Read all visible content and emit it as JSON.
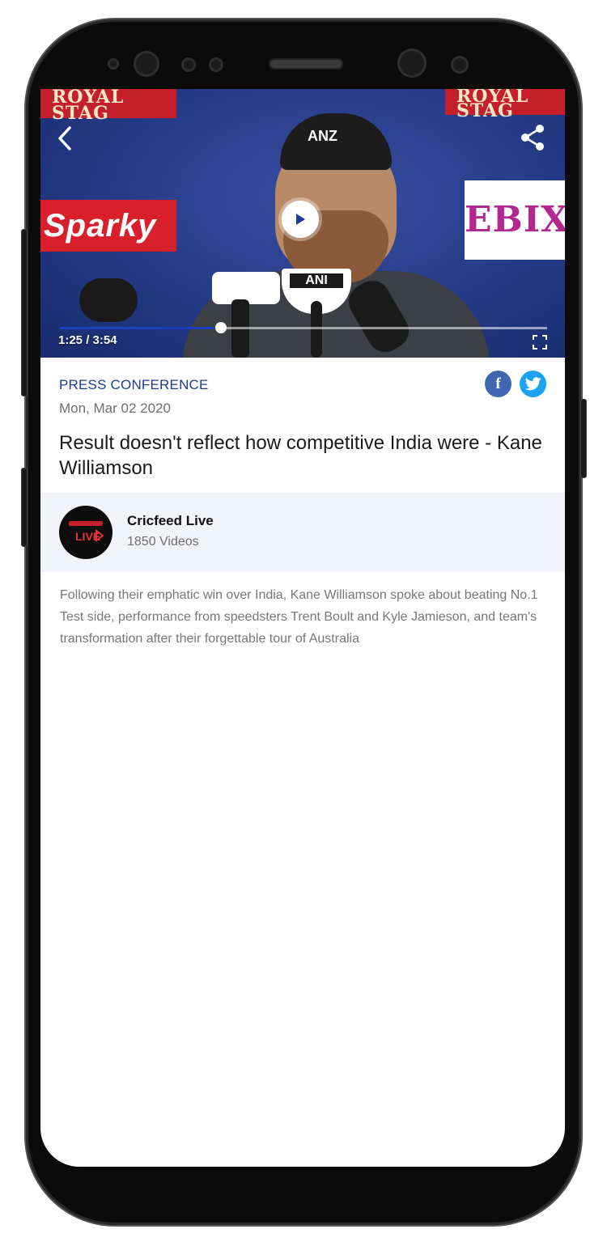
{
  "video": {
    "current_time": "1:25",
    "duration": "3:54",
    "time_label": "1:25 / 3:54",
    "progress": 0.33,
    "sponsors": [
      "ROYAL STAG",
      "Sparky",
      "EBIX",
      "ANZ",
      "ANI"
    ]
  },
  "header": {
    "back_icon": "chevron-left-icon",
    "share_icon": "share-icon"
  },
  "article": {
    "category": "PRESS CONFERENCE",
    "date": "Mon, Mar 02 2020",
    "title": "Result doesn't reflect how competitive India were - Kane Williamson",
    "description": "Following their emphatic win over India, Kane Williamson spoke about beating No.1 Test side, performance from speedsters Trent Boult and Kyle Jamieson, and team's transformation after their forgettable tour of Australia"
  },
  "social": {
    "facebook_label": "f",
    "facebook_color": "#4267b2",
    "twitter_color": "#1da1f2"
  },
  "channel": {
    "name": "Cricfeed Live",
    "videos": "1850 Videos"
  },
  "colors": {
    "accent": "#1d3e94",
    "channel_bg": "#f3f4f9"
  }
}
